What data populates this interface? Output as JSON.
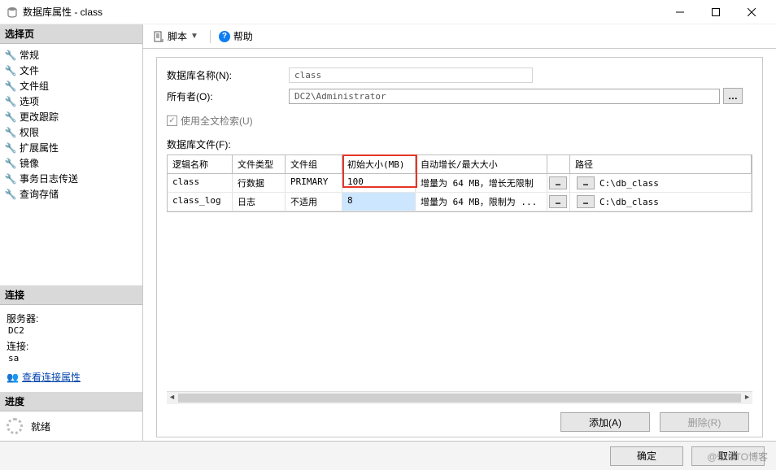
{
  "window": {
    "title": "数据库属性 - class",
    "watermark": "@51CTO博客"
  },
  "sidebar": {
    "select_page_header": "选择页",
    "nav_items": [
      "常规",
      "文件",
      "文件组",
      "选项",
      "更改跟踪",
      "权限",
      "扩展属性",
      "镜像",
      "事务日志传送",
      "查询存储"
    ],
    "connection_header": "连接",
    "server_label": "服务器:",
    "server_value": "DC2",
    "conn_label": "连接:",
    "conn_value": "sa",
    "view_conn_props": "查看连接属性",
    "progress_header": "进度",
    "progress_status": "就绪"
  },
  "toolbar": {
    "script_label": "脚本",
    "help_label": "帮助"
  },
  "form": {
    "db_name_label": "数据库名称(N):",
    "db_name_value": "class",
    "owner_label": "所有者(O):",
    "owner_value": "DC2\\Administrator",
    "fulltext_label": "使用全文检索(U)",
    "files_label": "数据库文件(F):"
  },
  "grid": {
    "headers": {
      "logical_name": "逻辑名称",
      "file_type": "文件类型",
      "filegroup": "文件组",
      "init_size": "初始大小(MB)",
      "autogrow": "自动增长/最大大小",
      "path": "路径"
    },
    "rows": [
      {
        "logical_name": "class",
        "file_type": "行数据",
        "filegroup": "PRIMARY",
        "init_size": "100",
        "autogrow": "增量为 64 MB，增长无限制",
        "path": "C:\\db_class"
      },
      {
        "logical_name": "class_log",
        "file_type": "日志",
        "filegroup": "不适用",
        "init_size": "8",
        "autogrow": "增量为 64 MB，限制为 ...",
        "path": "C:\\db_class"
      }
    ]
  },
  "buttons": {
    "add": "添加(A)",
    "delete": "删除(R)",
    "ok": "确定",
    "cancel": "取消"
  }
}
